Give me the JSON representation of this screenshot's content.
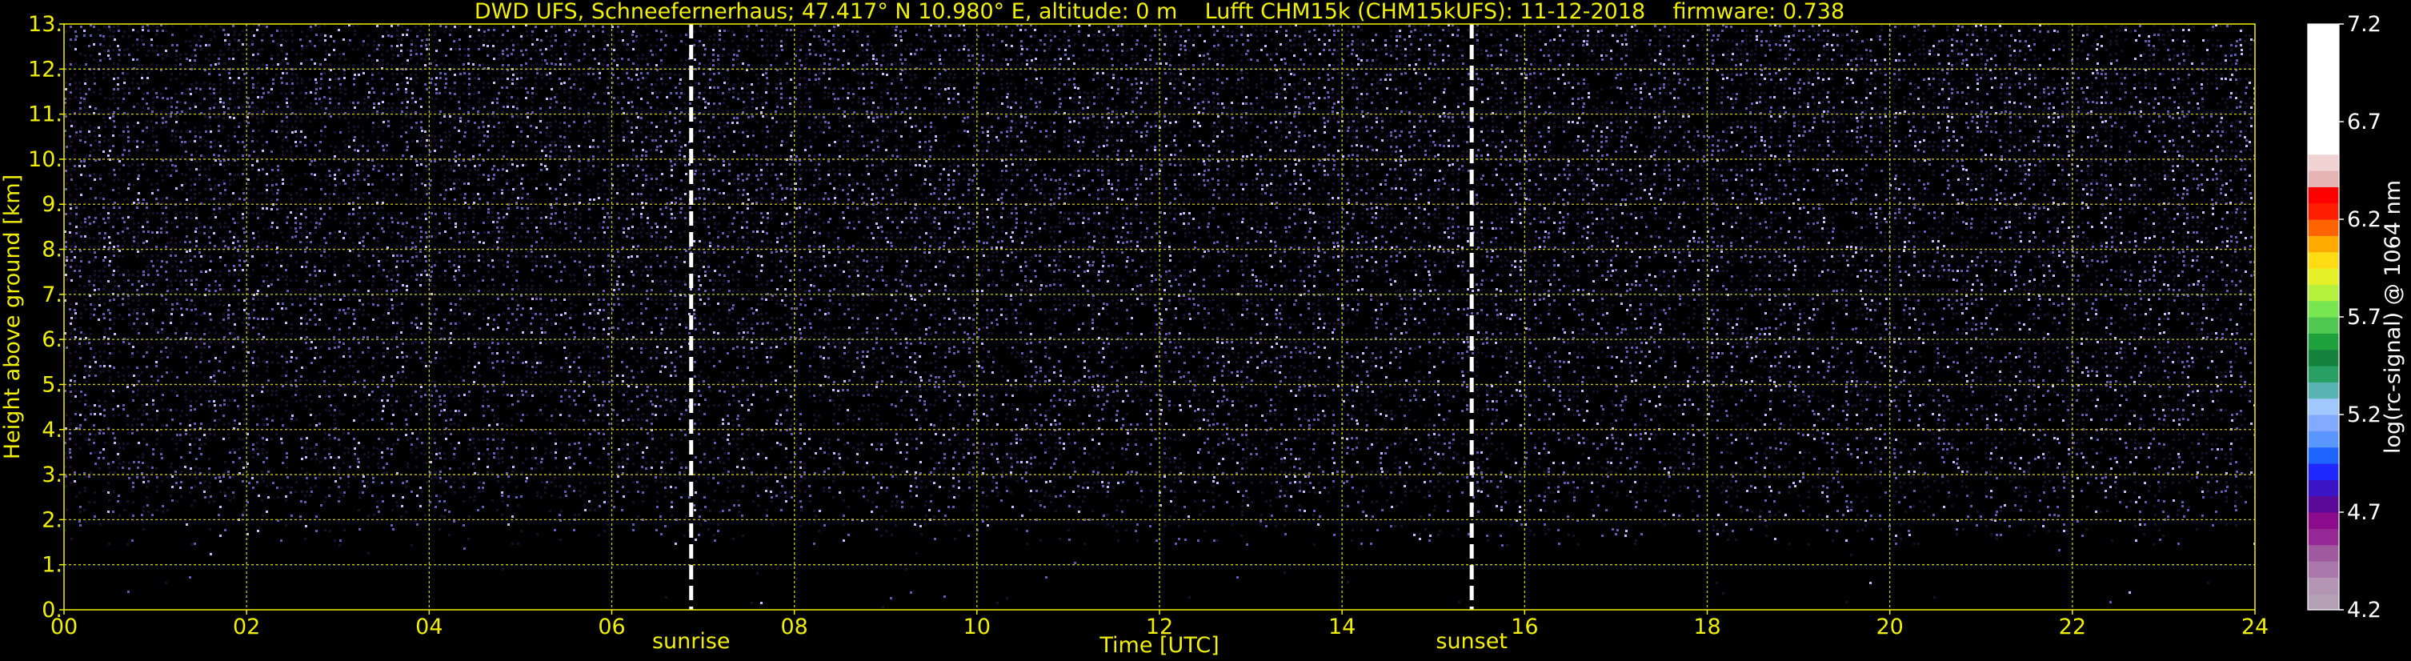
{
  "title": "DWD UFS, Schneefernerhaus; 47.417° N 10.980° E, altitude: 0 m    Lufft CHM15k (CHM15kUFS): 11-12-2018    firmware: 0.738",
  "chart_data": {
    "type": "heatmap",
    "title": "DWD UFS, Schneefernerhaus; 47.417° N 10.980° E, altitude: 0 m    Lufft CHM15k (CHM15kUFS): 11-12-2018    firmware: 0.738",
    "xlabel": "Time [UTC]",
    "ylabel": "Height above ground [km]",
    "xlim": [
      0,
      24
    ],
    "ylim": [
      0,
      13
    ],
    "x_ticks": [
      0,
      2,
      4,
      6,
      8,
      10,
      12,
      14,
      16,
      18,
      20,
      22,
      24
    ],
    "x_tick_labels": [
      "00",
      "02",
      "04",
      "06",
      "08",
      "10",
      "12",
      "14",
      "16",
      "18",
      "20",
      "22",
      "24"
    ],
    "y_ticks": [
      0,
      1,
      2,
      3,
      4,
      5,
      6,
      7,
      8,
      9,
      10,
      11,
      12,
      13
    ],
    "y_tick_labels": [
      "0.",
      "1.",
      "2.",
      "3.",
      "4.",
      "5.",
      "6.",
      "7.",
      "8.",
      "9.",
      "10.",
      "11.",
      "12.",
      "13."
    ],
    "grid": true,
    "annotations": [
      {
        "label": "sunrise",
        "x": 6.87
      },
      {
        "label": "sunset",
        "x": 15.42
      }
    ],
    "colorbar": {
      "label": "log(rc-signal) @ 1064 nm",
      "min": 4.2,
      "max": 7.2,
      "ticks": [
        4.2,
        4.7,
        5.2,
        5.7,
        6.2,
        6.7,
        7.2
      ],
      "tick_labels": [
        "4.2",
        "4.7",
        "5.2",
        "5.7",
        "6.2",
        "6.7",
        "7.2"
      ],
      "colors": [
        "#b4a0b4",
        "#b496b4",
        "#aa78aa",
        "#a05aa0",
        "#962896",
        "#8c0a8c",
        "#5a0a96",
        "#3c14c8",
        "#1e28ff",
        "#1e64ff",
        "#5a96ff",
        "#82aaff",
        "#a0c8ff",
        "#5ab4b4",
        "#28a064",
        "#14823c",
        "#1ea03c",
        "#50c850",
        "#78e650",
        "#b4f03c",
        "#e6f028",
        "#ffdc14",
        "#ffaa00",
        "#ff6400",
        "#ff1e00",
        "#ff0000",
        "#e6b4b4",
        "#f0d2d2",
        "#ffffff",
        "#ffffff",
        "#ffffff",
        "#ffffff",
        "#ffffff",
        "#ffffff",
        "#ffffff",
        "#ffffff"
      ]
    }
  },
  "colors": {
    "background": "#000000",
    "text": "#f0f000",
    "grid": "#c8c800",
    "sun_lines": "#ffffff",
    "noise_dark": "#1a0f2a",
    "noise_mid": "#6a58b0",
    "noise_light": "#c8bcff"
  }
}
